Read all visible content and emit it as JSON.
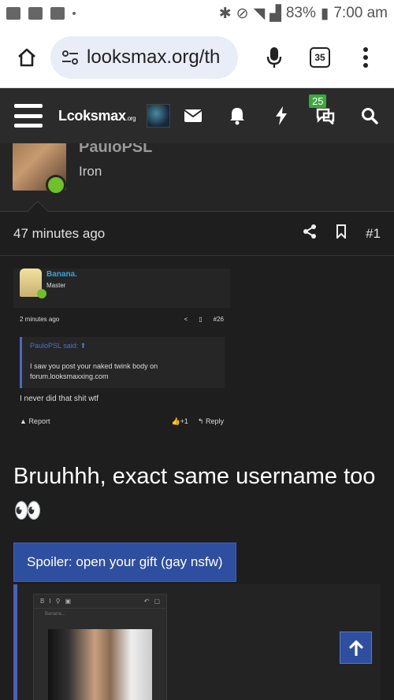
{
  "status_bar": {
    "battery": "83%",
    "time": "7:00 am"
  },
  "browser": {
    "url": "looksmax.org/th",
    "tab_count": "35"
  },
  "site_nav": {
    "logo_main": "Lcoksmax",
    "logo_suffix": ".org",
    "notification_badge": "25"
  },
  "profile": {
    "username": "PauloPSL",
    "rank": "Iron"
  },
  "post": {
    "time": "47 minutes ago",
    "number": "#1",
    "body": "Bruuhhh, exact same username too 👀",
    "spoiler_label": "Spoiler: open your gift (gay nsfw)"
  },
  "embedded": {
    "username": "Banana.",
    "rank": "Master",
    "time": "2 minutes ago",
    "number": "#26",
    "quote_author": "PauloPSL said:",
    "quote_text": "I saw you post your naked twink body on forum.looksmaxxing.com",
    "reply": "I never did that shit wtf",
    "report": "Report",
    "likes": "+1",
    "reply_btn": "Reply"
  },
  "editor": {
    "placeholder": "Banana..."
  },
  "colors": {
    "accent": "#2e4fa0",
    "online": "#6fc02a",
    "link": "#35a4d8"
  }
}
